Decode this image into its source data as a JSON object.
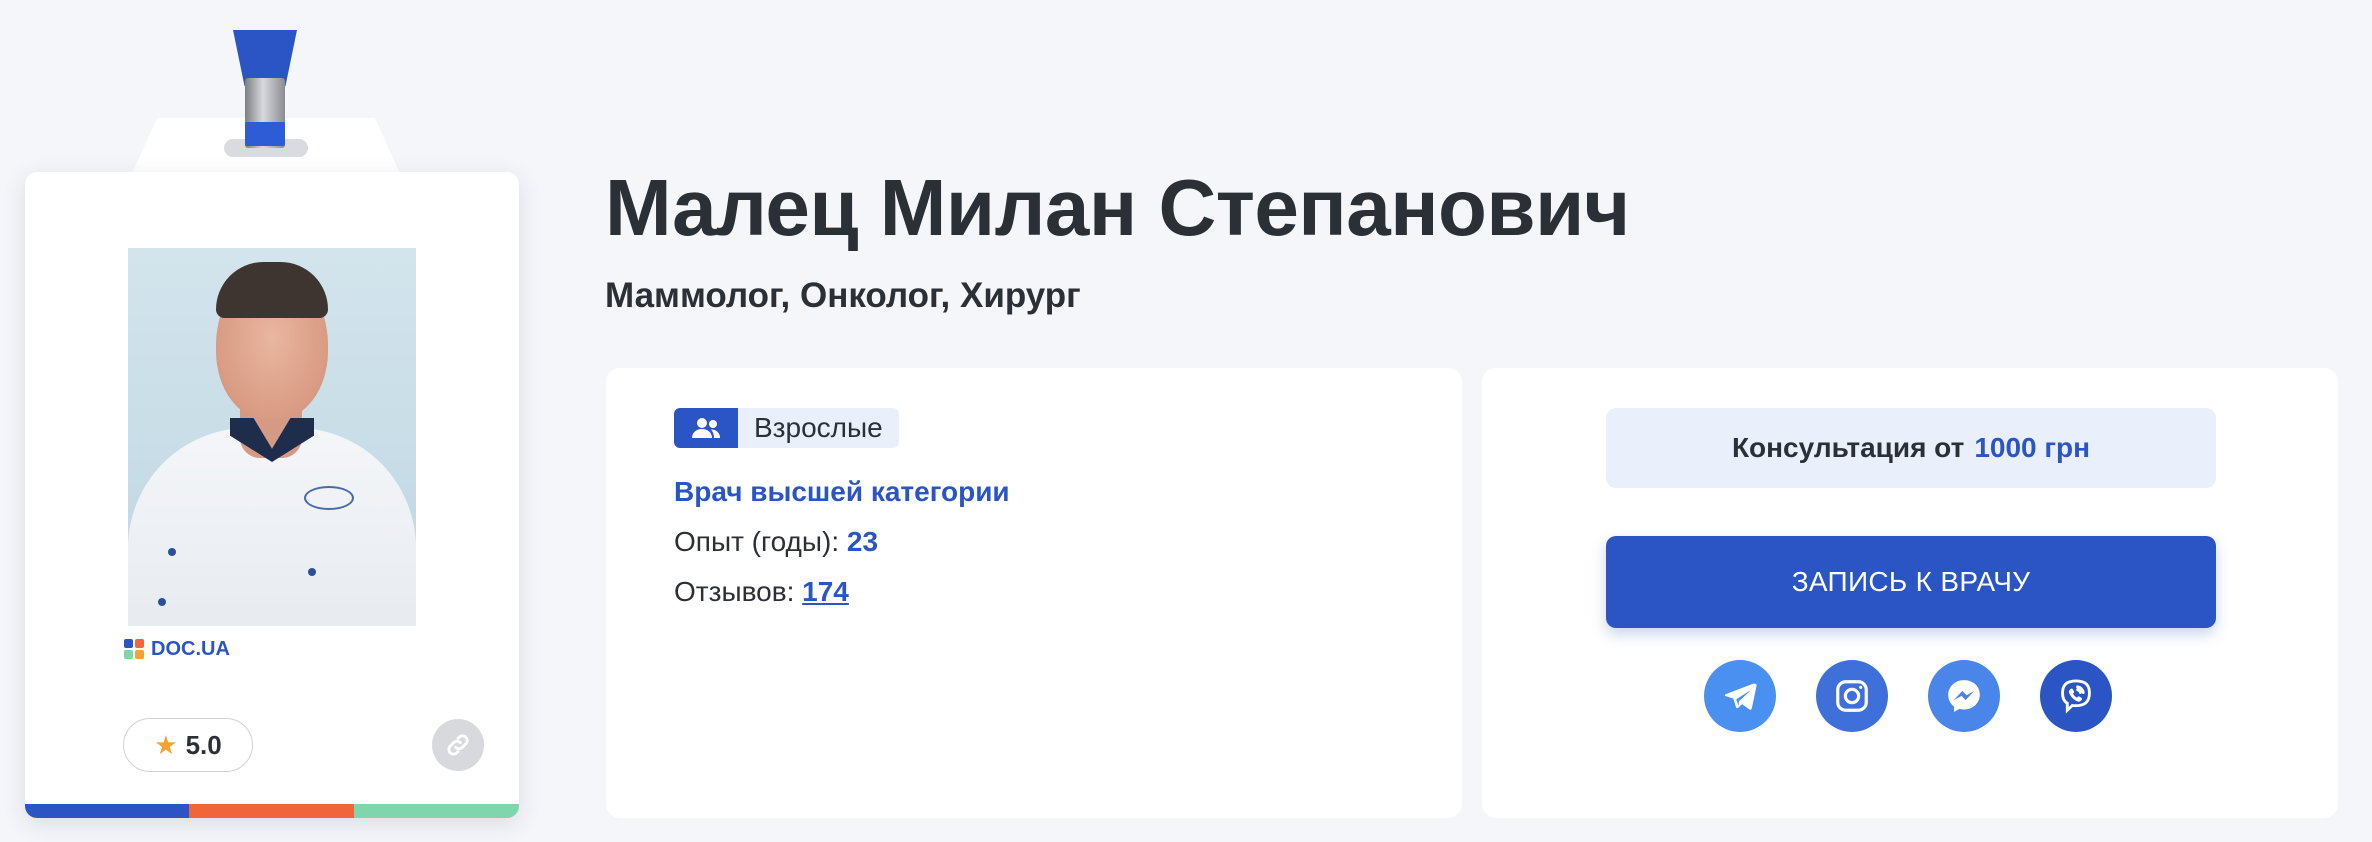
{
  "badge": {
    "brand": "DOC.UA",
    "rating": "5.0",
    "stripe_colors": [
      "#2b55c4",
      "#f0663a",
      "#7fd6ad"
    ]
  },
  "doctor": {
    "name": "Малец Милан Степанович",
    "specialties": "Маммолог, Онколог, Хирург"
  },
  "info": {
    "age_group": "Взрослые",
    "category": "Врач высшей категории",
    "experience_label": "Опыт (годы):",
    "experience_value": "23",
    "reviews_label": "Отзывов:",
    "reviews_value": "174"
  },
  "booking": {
    "price_label": "Консультация от",
    "price_value": "1000 грн",
    "cta_label": "ЗАПИСЬ К ВРАЧУ",
    "socials": [
      {
        "name": "telegram-icon",
        "color": "#4a90f0"
      },
      {
        "name": "instagram-icon",
        "color": "#3f6fd8"
      },
      {
        "name": "messenger-icon",
        "color": "#4a86ea"
      },
      {
        "name": "viber-icon",
        "color": "#2b55c4"
      }
    ]
  },
  "colors": {
    "accent": "#2b55c4",
    "background": "#f5f6fa",
    "star": "#f3a233"
  }
}
